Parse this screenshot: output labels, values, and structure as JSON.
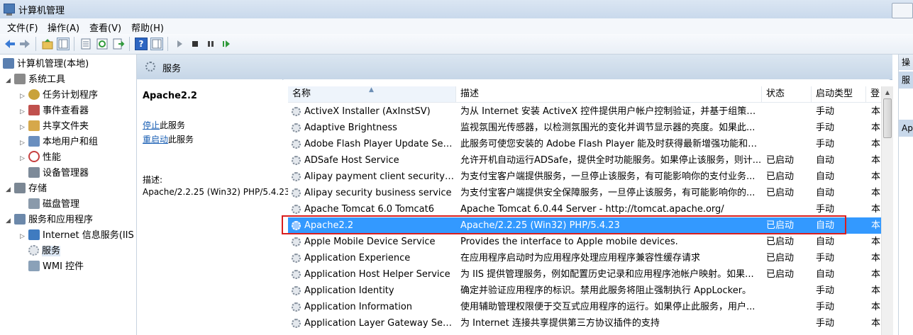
{
  "window": {
    "title": "计算机管理"
  },
  "menu": [
    "文件(F)",
    "操作(A)",
    "查看(V)",
    "帮助(H)"
  ],
  "tree": [
    {
      "label": "计算机管理(本地)",
      "color": "#5a7fb0"
    },
    {
      "label": "系统工具",
      "color": "#8a8a8a"
    },
    {
      "label": "任务计划程序",
      "color": "#c9a23a"
    },
    {
      "label": "事件查看器",
      "color": "#c0504d"
    },
    {
      "label": "共享文件夹",
      "color": "#d6a84a"
    },
    {
      "label": "本地用户和组",
      "color": "#6a8fbf"
    },
    {
      "label": "性能",
      "color": "#c64040"
    },
    {
      "label": "设备管理器",
      "color": "#7d8a99"
    },
    {
      "label": "存储",
      "color": "#7b8794"
    },
    {
      "label": "磁盘管理",
      "color": "#8a9aab"
    },
    {
      "label": "服务和应用程序",
      "color": "#6c88aa"
    },
    {
      "label": "Internet 信息服务(IIS",
      "color": "#3f7bc0"
    },
    {
      "label": "服务",
      "color": "#8b96a3"
    },
    {
      "label": "WMI 控件",
      "color": "#8aa1b8"
    }
  ],
  "center": {
    "header": "服务",
    "extended": {
      "title": "Apache2.2",
      "stop_link": "停止",
      "stop_suffix": "此服务",
      "restart_link": "重启动",
      "restart_suffix": "此服务",
      "desc_label": "描述:",
      "desc": "Apache/2.2.25 (Win32) PHP/5.4.23"
    }
  },
  "columns": {
    "name": "名称",
    "desc": "描述",
    "status": "状态",
    "startup": "启动类型",
    "logon": "登"
  },
  "services": [
    {
      "name": "ActiveX Installer (AxInstSV)",
      "desc": "为从 Internet 安装 ActiveX 控件提供用户帐户控制验证，并基于组策略...",
      "status": "",
      "startup": "手动",
      "logon": "本"
    },
    {
      "name": "Adaptive Brightness",
      "desc": "监视氛围光传感器，以检测氛围光的变化并调节显示器的亮度。如果此...",
      "status": "",
      "startup": "手动",
      "logon": "本"
    },
    {
      "name": "Adobe Flash Player Update Servi...",
      "desc": "此服务可使您安装的 Adobe Flash Player 能及时获得最新增强功能和安...",
      "status": "",
      "startup": "手动",
      "logon": "本"
    },
    {
      "name": "ADSafe Host Service",
      "desc": "允许开机自动运行ADSafe，提供全时功能服务。如果停止该服务，则计...",
      "status": "已启动",
      "startup": "自动",
      "logon": "本"
    },
    {
      "name": "Alipay payment client security se...",
      "desc": "为支付宝客户端提供服务，一旦停止该服务，有可能影响你的支付业务...",
      "status": "已启动",
      "startup": "自动",
      "logon": "本"
    },
    {
      "name": "Alipay security business service",
      "desc": "为支付宝客户端提供安全保障服务，一旦停止该服务，有可能影响你的...",
      "status": "已启动",
      "startup": "自动",
      "logon": "本"
    },
    {
      "name": "Apache Tomcat 6.0 Tomcat6",
      "desc": "Apache Tomcat 6.0.44 Server - http://tomcat.apache.org/",
      "status": "",
      "startup": "手动",
      "logon": "本"
    },
    {
      "name": "Apache2.2",
      "desc": "Apache/2.2.25 (Win32) PHP/5.4.23",
      "status": "已启动",
      "startup": "自动",
      "logon": "本"
    },
    {
      "name": "Apple Mobile Device Service",
      "desc": "Provides the interface to Apple mobile devices.",
      "status": "已启动",
      "startup": "自动",
      "logon": "本"
    },
    {
      "name": "Application Experience",
      "desc": "在应用程序启动时为应用程序处理应用程序兼容性缓存请求",
      "status": "已启动",
      "startup": "手动",
      "logon": "本"
    },
    {
      "name": "Application Host Helper Service",
      "desc": "为 IIS 提供管理服务，例如配置历史记录和应用程序池帐户映射。如果...",
      "status": "已启动",
      "startup": "自动",
      "logon": "本"
    },
    {
      "name": "Application Identity",
      "desc": "确定并验证应用程序的标识。禁用此服务将阻止强制执行 AppLocker。",
      "status": "",
      "startup": "手动",
      "logon": "本"
    },
    {
      "name": "Application Information",
      "desc": "使用辅助管理权限便于交互式应用程序的运行。如果停止此服务，用户...",
      "status": "",
      "startup": "手动",
      "logon": "本"
    },
    {
      "name": "Application Layer Gateway Service",
      "desc": "为 Internet 连接共享提供第三方协议插件的支持",
      "status": "",
      "startup": "手动",
      "logon": "本"
    }
  ],
  "actions": {
    "head": "操",
    "sub1": "服",
    "sub2": "Ap"
  }
}
